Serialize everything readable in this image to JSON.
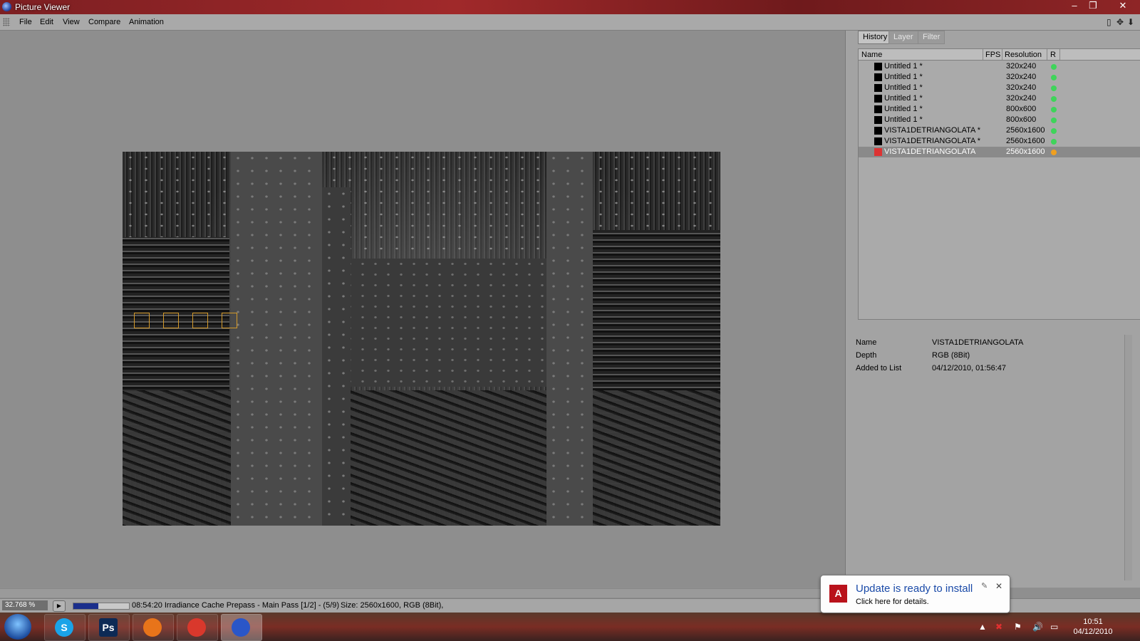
{
  "window": {
    "title": "Picture Viewer",
    "minimize": "–",
    "restore": "❐",
    "close": "✕"
  },
  "menu": [
    "File",
    "Edit",
    "View",
    "Compare",
    "Animation"
  ],
  "panel": {
    "tabs": [
      "History",
      "Layer",
      "Filter"
    ],
    "columns": {
      "name": "Name",
      "fps": "FPS",
      "resolution": "Resolution",
      "r": "R"
    },
    "rows": [
      {
        "name": "Untitled 1 *",
        "resolution": "320x240",
        "status_color": "#3fd45a"
      },
      {
        "name": "Untitled 1 *",
        "resolution": "320x240",
        "status_color": "#3fd45a"
      },
      {
        "name": "Untitled 1 *",
        "resolution": "320x240",
        "status_color": "#3fd45a"
      },
      {
        "name": "Untitled 1 *",
        "resolution": "320x240",
        "status_color": "#3fd45a"
      },
      {
        "name": "Untitled 1 *",
        "resolution": "800x600",
        "status_color": "#3fd45a"
      },
      {
        "name": "Untitled 1 *",
        "resolution": "800x600",
        "status_color": "#3fd45a"
      },
      {
        "name": "VISTA1DETRIANGOLATA *",
        "resolution": "2560x1600",
        "status_color": "#3fd45a"
      },
      {
        "name": "VISTA1DETRIANGOLATA *",
        "resolution": "2560x1600",
        "status_color": "#3fd45a"
      },
      {
        "name": "VISTA1DETRIANGOLATA",
        "resolution": "2560x1600",
        "status_color": "#f0a020",
        "selected": true
      }
    ],
    "info": [
      {
        "key": "Name",
        "value": "VISTA1DETRIANGOLATA"
      },
      {
        "key": "Depth",
        "value": "RGB (8Bit)"
      },
      {
        "key": "Added to List",
        "value": "04/12/2010, 01:56:47"
      }
    ]
  },
  "status": {
    "zoom": "32.768 %",
    "progress": 0.45,
    "text": "08:54:20 Irradiance Cache Prepass - Main Pass [1/2] - (5/9)",
    "size": "Size: 2560x1600, RGB (8Bit),"
  },
  "notification": {
    "title": "Update is ready to install",
    "body": "Click here for details."
  },
  "taskbar": {
    "apps": [
      {
        "name": "skype",
        "glyph": "S",
        "color": "#1aa3e8"
      },
      {
        "name": "photoshop",
        "glyph": "Ps",
        "color": "#0d2a55"
      },
      {
        "name": "firefox",
        "glyph": "",
        "color": "#e8741a"
      },
      {
        "name": "chrome",
        "glyph": "",
        "color": "#d9382c"
      },
      {
        "name": "cinema4d",
        "glyph": "",
        "color": "#2a56c8",
        "active": true
      }
    ],
    "time": "10:51",
    "date": "04/12/2010"
  },
  "colors": {
    "accent": "#1b2f8c",
    "bucket": "#d49a2a"
  }
}
